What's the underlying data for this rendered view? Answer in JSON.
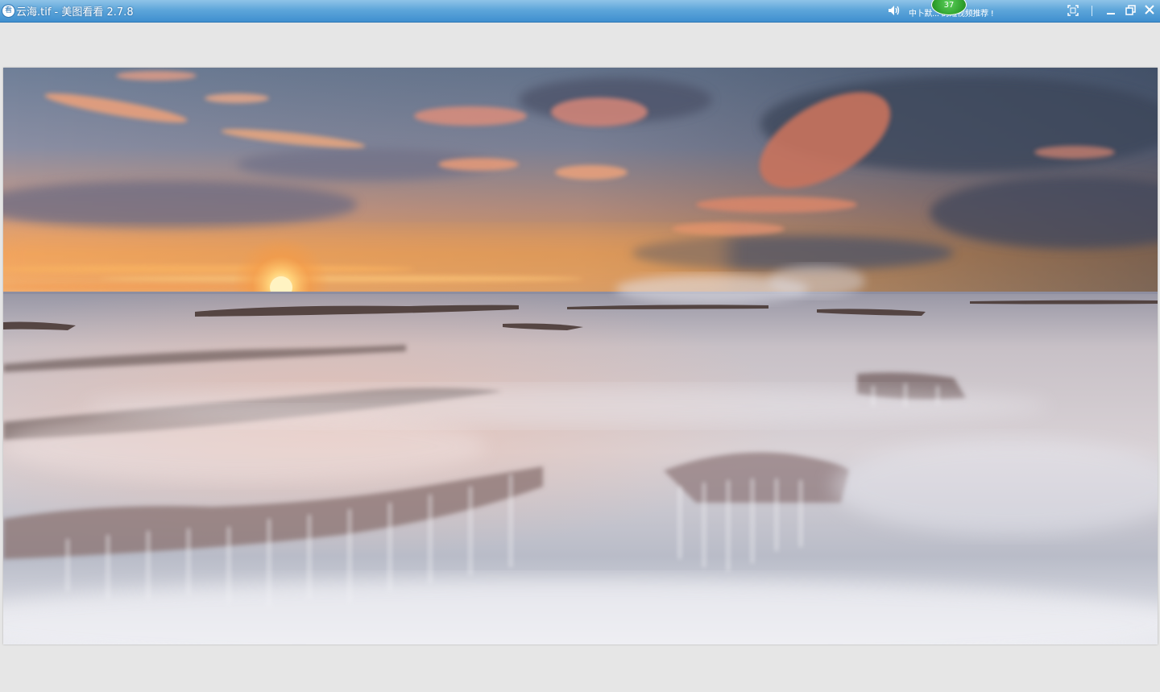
{
  "window": {
    "app_icon_glyph": "看",
    "title": "云海.tif - 美图看看 2.7.8"
  },
  "titlebar": {
    "notice_text": "中卜默... 的短视频推荐 !",
    "badge_count": "37",
    "icons": {
      "volume": "speaker-icon",
      "fullscreen": "fullscreen-icon",
      "minimize": "minimize-icon",
      "restore": "restore-icon",
      "close": "close-icon"
    }
  },
  "viewer": {
    "image_subject": "seascape at sunset with long-exposure waves over rock shelves"
  },
  "colors": {
    "titlebar_top": "#8fc3e8",
    "titlebar_bottom": "#3f8fcf",
    "viewer_bg": "#e6e6e6",
    "badge_green": "#2e9f2c"
  }
}
